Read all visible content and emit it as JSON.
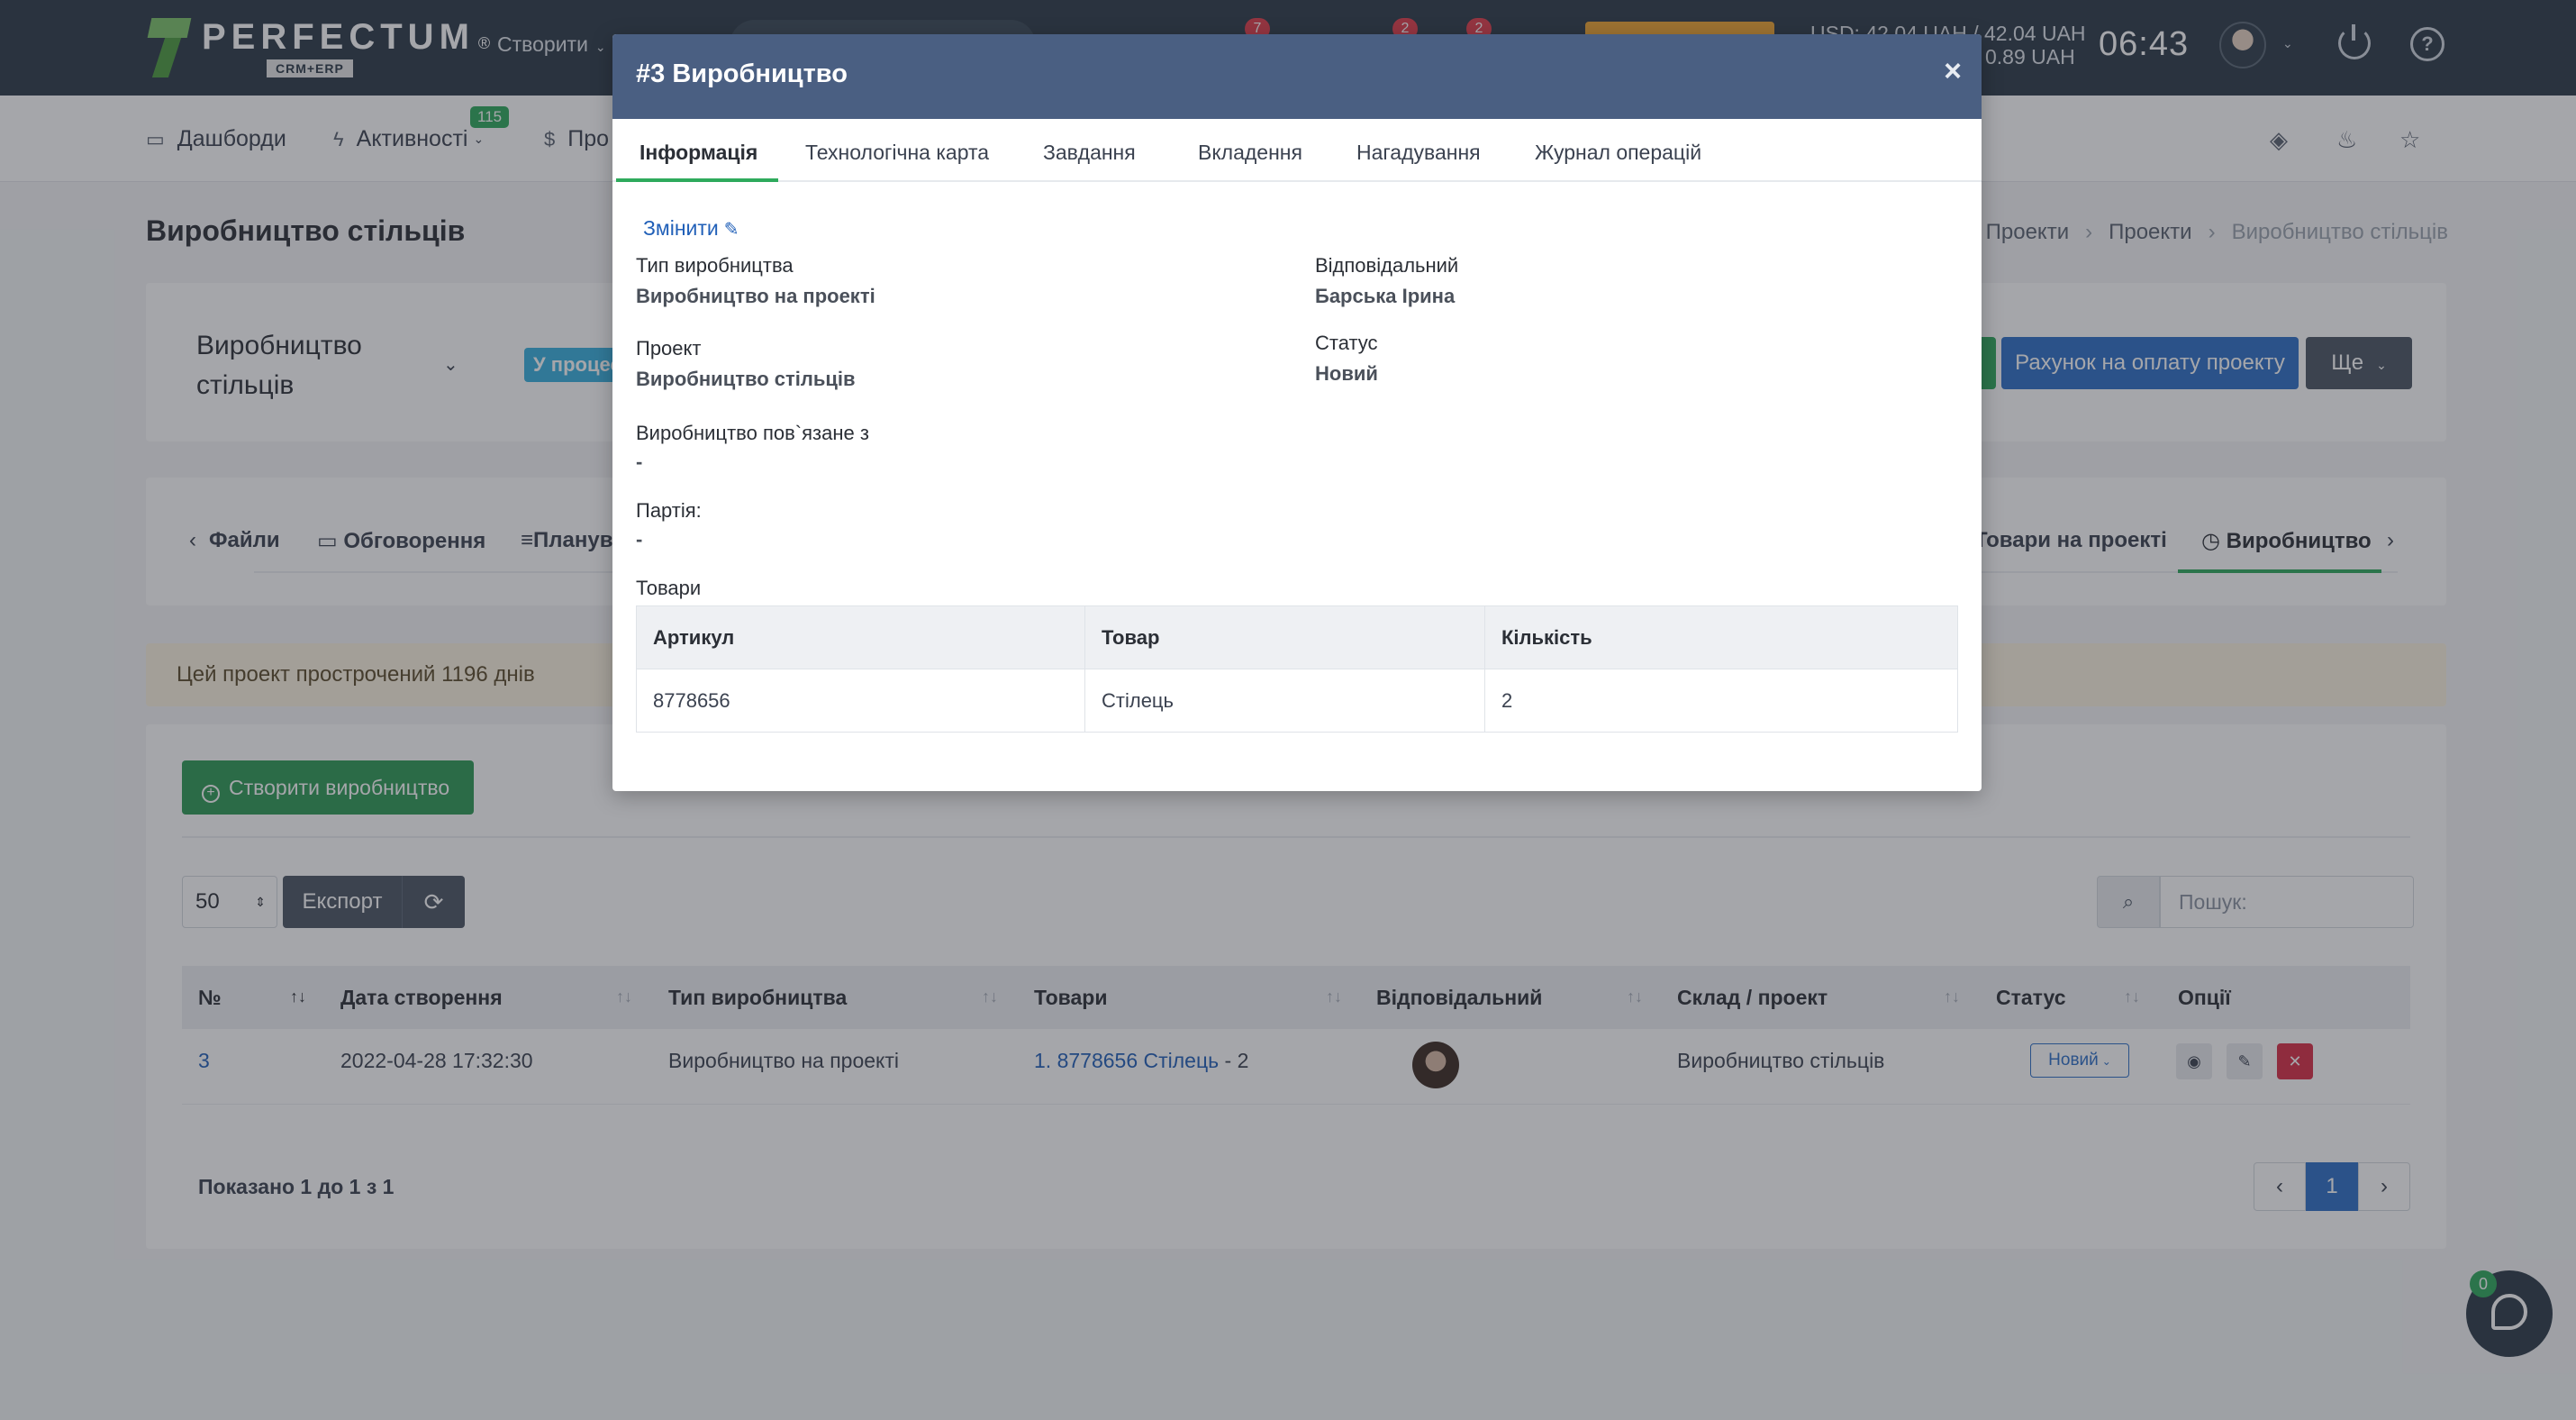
{
  "app": {
    "logo_name": "PERFECTUM",
    "logo_sub": "CRM+ERP",
    "logo_reg": "®",
    "create_label": "Створити",
    "top_badges": [
      "7",
      "2",
      "2"
    ],
    "rates_line1": "USD: 42.04 UAH / 42.04 UAH",
    "rates_line2": "0.89 UAH",
    "clock": "06:43"
  },
  "subnav": {
    "dashboards": "Дашборди",
    "activities": "Активності",
    "activities_badge": "115",
    "projects": "Про"
  },
  "page": {
    "title": "Виробництво стільців",
    "breadcrumb": [
      "Проекти",
      "Проекти",
      "Виробництво стільців"
    ]
  },
  "project": {
    "name_line1": "Виробництво",
    "name_line2": "стільців",
    "status": "У процес",
    "invoice_button": "Рахунок на оплату проекту",
    "more_button": "Ще"
  },
  "project_tabs": {
    "files": "Файли",
    "discussions": "Обговорення",
    "planning": "Планув",
    "goods_on_project": "Товари на проекті",
    "production": "Виробництво"
  },
  "alert": "Цей проект прострочений 1196 днів",
  "list": {
    "create_button": "Створити виробництво",
    "page_size": "50",
    "export_button": "Експорт",
    "search_placeholder": "Пошук:",
    "columns": [
      "№",
      "Дата створення",
      "Тип виробництва",
      "Товари",
      "Відповідальний",
      "Склад / проект",
      "Статус",
      "Опції"
    ],
    "row": {
      "num": "3",
      "created": "2022-04-28 17:32:30",
      "type": "Виробництво на проекті",
      "goods_link": "1. 8778656 Стілець",
      "goods_qty": " - 2",
      "warehouse": "Виробництво стільців",
      "status": "Новий"
    },
    "shown": "Показано 1 до 1 з 1",
    "page": "1"
  },
  "chat_badge": "0",
  "modal": {
    "title": "#3 Виробництво",
    "close": "×",
    "tabs": [
      "Інформація",
      "Технологічна карта",
      "Завдання",
      "Вкладення",
      "Нагадування",
      "Журнал операцій"
    ],
    "edit_link": "Змінити",
    "fields": {
      "type_label": "Тип виробництва",
      "type_value": "Виробництво на проекті",
      "project_label": "Проект",
      "project_value": "Виробництво стільців",
      "linked_label": "Виробництво пов`язане з",
      "linked_value": "-",
      "batch_label": "Партія:",
      "batch_value": "-",
      "goods_label": "Товари",
      "responsible_label": "Відповідальний",
      "responsible_value": "Барська Ірина",
      "status_label": "Статус",
      "status_value": "Новий"
    },
    "goods_table": {
      "headers": [
        "Артикул",
        "Товар",
        "Кількість"
      ],
      "row": [
        "8778656",
        "Стілець",
        "2"
      ]
    }
  },
  "colors": {
    "topbar": "#2c3a47",
    "modal_header": "#4a5f82",
    "accent_green": "#2eaa5c",
    "primary_blue": "#2d6fc7",
    "danger": "#d92d45"
  }
}
